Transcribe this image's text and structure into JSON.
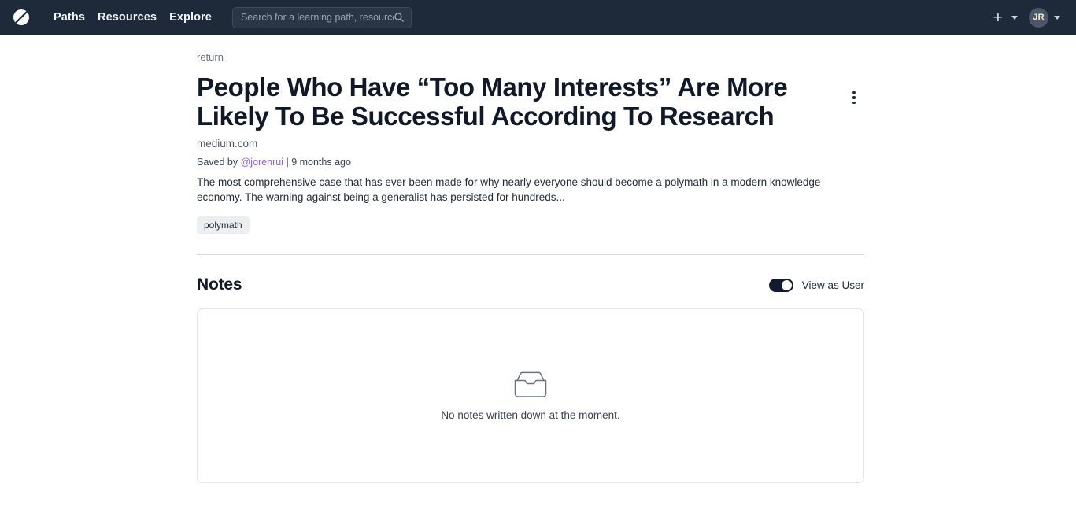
{
  "navbar": {
    "logo_icon": "slash-circle-logo",
    "links": [
      {
        "label": "Paths"
      },
      {
        "label": "Resources"
      },
      {
        "label": "Explore"
      }
    ],
    "search": {
      "placeholder": "Search for a learning path, resource",
      "value": "",
      "icon": "search-icon"
    },
    "add_button": "+",
    "add_caret_icon": "chevron-down-icon",
    "avatar_initials": "JR",
    "avatar_caret_icon": "chevron-down-icon",
    "background_color": "#1e2a3a"
  },
  "article": {
    "return_label": "return",
    "title": "People Who Have “Too Many Interests” Are More Likely To Be Successful According To Research",
    "menu_icon": "kebab-menu-icon",
    "source": "medium.com",
    "saved_prefix": "Saved by ",
    "saved_user": "@jorenrui",
    "saved_separator": " | ",
    "saved_time": "9 months ago",
    "description": "The most comprehensive case that has ever been made for why nearly everyone should become a polymath in a modern knowledge economy. The warning against being a generalist has persisted for hundreds...",
    "tags": [
      {
        "label": "polymath"
      }
    ],
    "link_color": "#8b5cf6"
  },
  "notes": {
    "heading": "Notes",
    "toggle_label": "View as User",
    "toggle_state": "on",
    "empty_icon": "inbox-icon",
    "empty_text": "No notes written down at the moment."
  }
}
